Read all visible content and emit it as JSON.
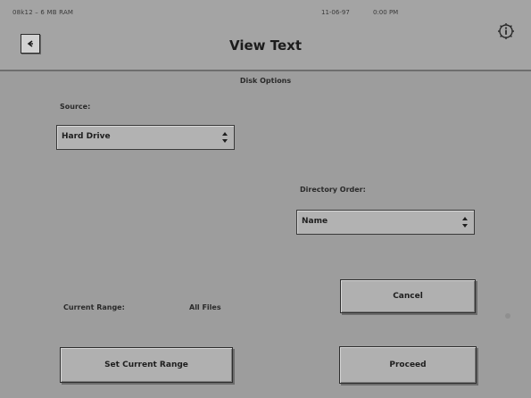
{
  "header": {
    "status_left": "08k12 – 6 MB RAM",
    "date": "11-06-97",
    "time": "0:00 PM",
    "title": "View Text",
    "back_icon": "back-arrow-icon",
    "info_icon": "info-icon"
  },
  "disk_options": {
    "section_label": "Disk Options",
    "source": {
      "label": "Source:",
      "selected": "Hard Drive"
    },
    "directory_order": {
      "label": "Directory Order:",
      "selected": "Name"
    }
  },
  "range": {
    "label": "Current Range:",
    "value": "All Files"
  },
  "buttons": {
    "cancel": "Cancel",
    "set_range": "Set Current Range",
    "proceed": "Proceed"
  }
}
